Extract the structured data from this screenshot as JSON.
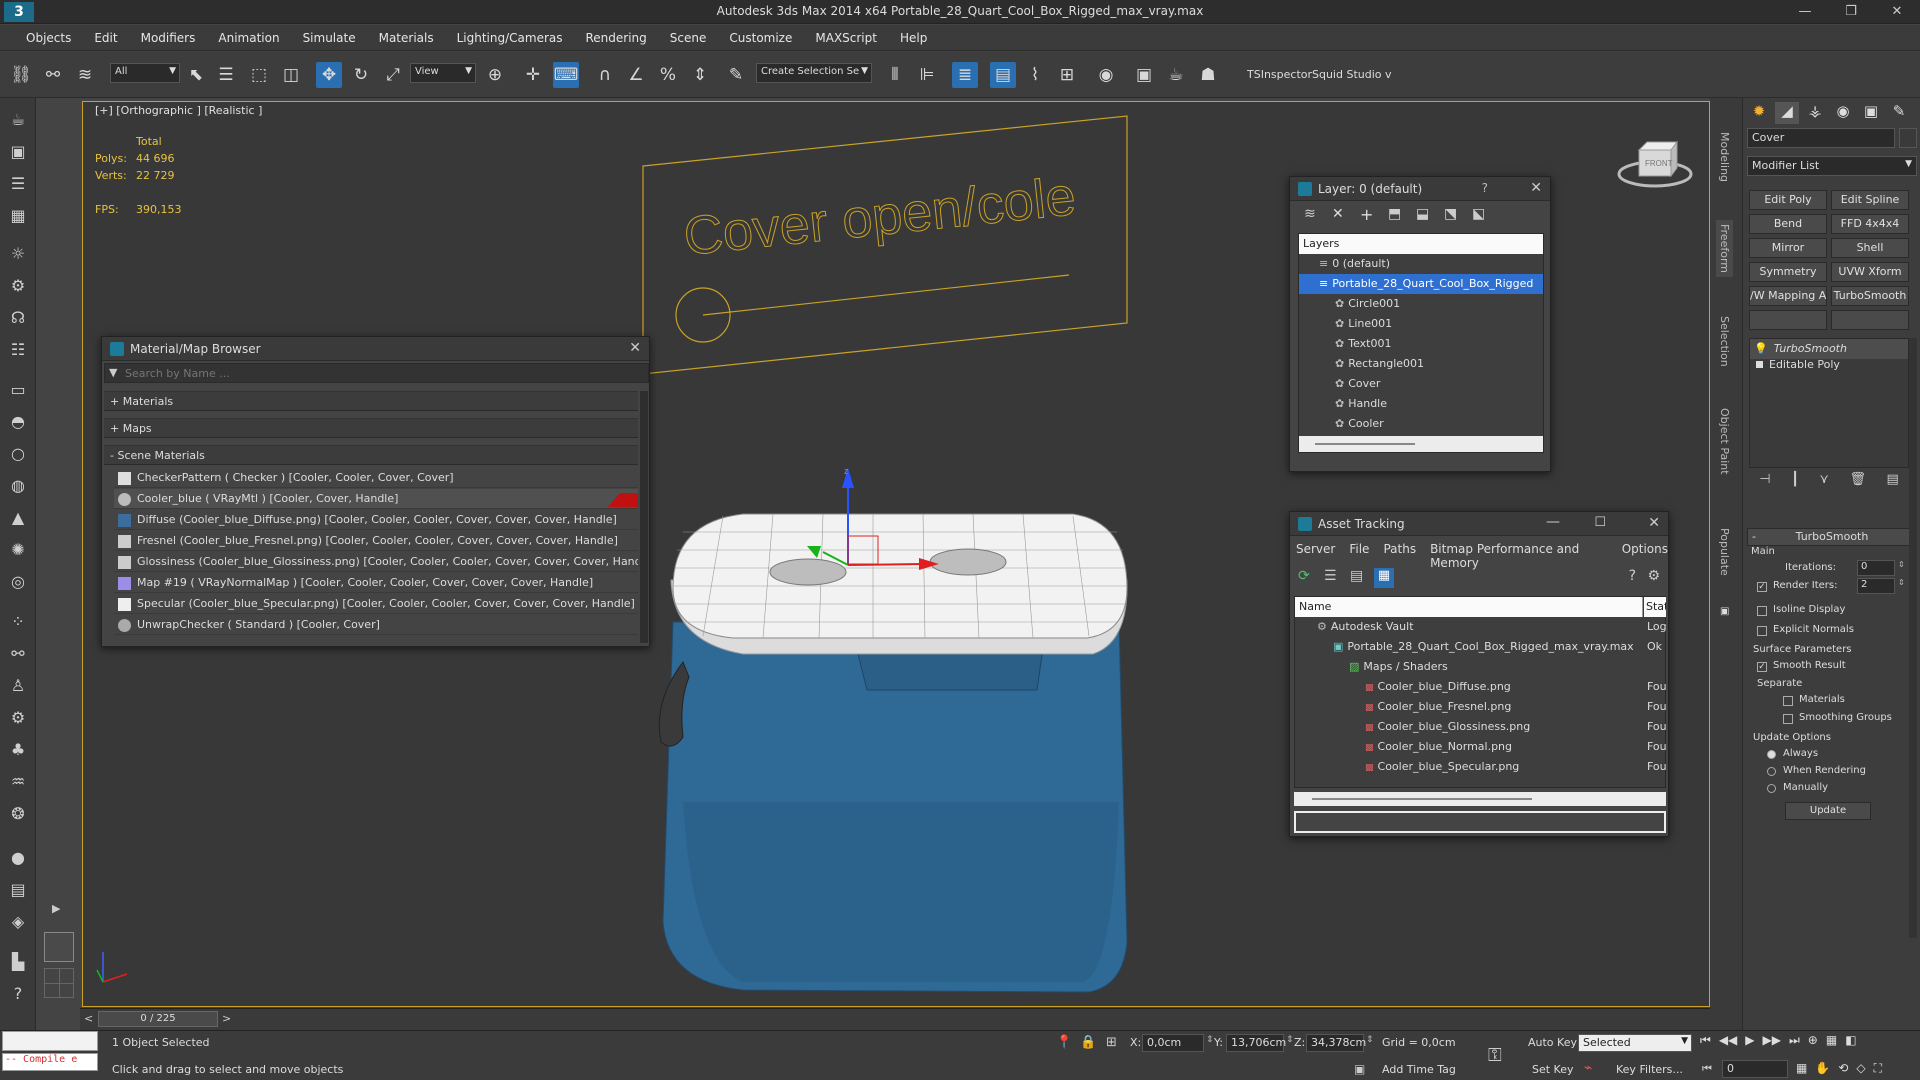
{
  "app": {
    "title": "Autodesk 3ds Max  2014 x64     Portable_28_Quart_Cool_Box_Rigged_max_vray.max"
  },
  "menu": [
    "Objects",
    "Edit",
    "Modifiers",
    "Animation",
    "Simulate",
    "Materials",
    "Lighting/Cameras",
    "Rendering",
    "Scene",
    "Customize",
    "MAXScript",
    "Help"
  ],
  "toolbar": {
    "filter": "All",
    "ref_coord": "View",
    "selection_set_placeholder": "Create Selection Se",
    "tsinspector": "TSInspector",
    "squid": "Squid Studio v"
  },
  "viewport": {
    "label": "[+] [Orthographic ] [Realistic ]",
    "stats": {
      "total_label": "Total",
      "polys_label": "Polys:",
      "polys": "44 696",
      "verts_label": "Verts:",
      "verts": "22 729",
      "fps_label": "FPS:",
      "fps": "390,153"
    },
    "scene_text": "Cover open/cole",
    "viewcube_label": "FRONT"
  },
  "material_browser": {
    "title": "Material/Map Browser",
    "search_placeholder": "Search by Name ...",
    "groups": [
      "+ Materials",
      "+ Maps",
      "- Scene Materials"
    ],
    "items": [
      "CheckerPattern  ( Checker )  [Cooler, Cooler, Cover, Cover]",
      "Cooler_blue  ( VRayMtl )  [Cooler, Cover, Handle]",
      "Diffuse (Cooler_blue_Diffuse.png) [Cooler, Cooler, Cooler, Cover, Cover, Cover, Handle]",
      "Fresnel (Cooler_blue_Fresnel.png) [Cooler, Cooler, Cooler, Cover, Cover, Cover, Handle]",
      "Glossiness (Cooler_blue_Glossiness.png) [Cooler, Cooler, Cooler, Cover, Cover, Cover, Handle]",
      "Map #19  ( VRayNormalMap )  [Cooler, Cooler, Cooler, Cover, Cover, Cover, Handle]",
      "Specular (Cooler_blue_Specular.png) [Cooler, Cooler, Cooler, Cover, Cover, Cover, Handle]",
      "UnwrapChecker  ( Standard )  [Cooler, Cover]"
    ],
    "selected_index": 1
  },
  "layer_window": {
    "title": "Layer: 0 (default)",
    "help": "?",
    "header": "Layers",
    "rows": [
      {
        "name": "0 (default)",
        "level": 1
      },
      {
        "name": "Portable_28_Quart_Cool_Box_Rigged",
        "level": 1
      },
      {
        "name": "Circle001",
        "level": 2
      },
      {
        "name": "Line001",
        "level": 2
      },
      {
        "name": "Text001",
        "level": 2
      },
      {
        "name": "Rectangle001",
        "level": 2
      },
      {
        "name": "Cover",
        "level": 2
      },
      {
        "name": "Handle",
        "level": 2
      },
      {
        "name": "Cooler",
        "level": 2
      }
    ],
    "selected_index": 1
  },
  "asset_tracking": {
    "title": "Asset Tracking",
    "menu": [
      "Server",
      "File",
      "Paths",
      "Bitmap Performance and Memory",
      "Options"
    ],
    "col_name": "Name",
    "col_status": "Stat",
    "rows": [
      {
        "name": "Autodesk Vault",
        "status": "Log",
        "level": 1
      },
      {
        "name": "Portable_28_Quart_Cool_Box_Rigged_max_vray.max",
        "status": "Ok",
        "level": 2
      },
      {
        "name": "Maps / Shaders",
        "status": "",
        "level": 3
      },
      {
        "name": "Cooler_blue_Diffuse.png",
        "status": "Fou",
        "level": 4
      },
      {
        "name": "Cooler_blue_Fresnel.png",
        "status": "Fou",
        "level": 4
      },
      {
        "name": "Cooler_blue_Glossiness.png",
        "status": "Fou",
        "level": 4
      },
      {
        "name": "Cooler_blue_Normal.png",
        "status": "Fou",
        "level": 4
      },
      {
        "name": "Cooler_blue_Specular.png",
        "status": "Fou",
        "level": 4
      }
    ]
  },
  "right_strip": [
    "Modeling",
    "Freeform",
    "Selection",
    "Object Paint",
    "Populate"
  ],
  "command_panel": {
    "object_name": "Cover",
    "modifier_list": "Modifier List",
    "buttons": [
      "Edit Poly",
      "Edit Spline",
      "Bend",
      "FFD 4x4x4",
      "Mirror",
      "Shell",
      "Symmetry",
      "UVW Xform",
      "/W Mapping Ac",
      "TurboSmooth"
    ],
    "stack": [
      "TurboSmooth",
      "Editable Poly"
    ],
    "rollout_title": "TurboSmooth",
    "main_label": "Main",
    "iterations_label": "Iterations:",
    "iterations": "0",
    "render_iters_label": "Render Iters:",
    "render_iters": "2",
    "isoline": "Isoline Display",
    "explicit_normals": "Explicit Normals",
    "surface_params": "Surface Parameters",
    "smooth_result": "Smooth Result",
    "separate": "Separate",
    "materials": "Materials",
    "smoothing_groups": "Smoothing Groups",
    "update_options": "Update Options",
    "always": "Always",
    "when_rendering": "When Rendering",
    "manually": "Manually",
    "update_btn": "Update"
  },
  "timeline": {
    "frame": "0 / 225"
  },
  "status": {
    "maxscript": "-- Compile e",
    "selected": "1 Object Selected",
    "prompt": "Click and drag to select and move objects",
    "x_label": "X:",
    "x": "0,0cm",
    "y_label": "Y:",
    "y": "13,706cm",
    "z_label": "Z:",
    "z": "34,378cm",
    "grid": "Grid = 0,0cm",
    "add_time_tag": "Add Time Tag",
    "auto_key": "Auto Key",
    "set_key": "Set Key",
    "key_mode": "Selected",
    "key_filters": "Key Filters...",
    "frame_field": "0"
  }
}
